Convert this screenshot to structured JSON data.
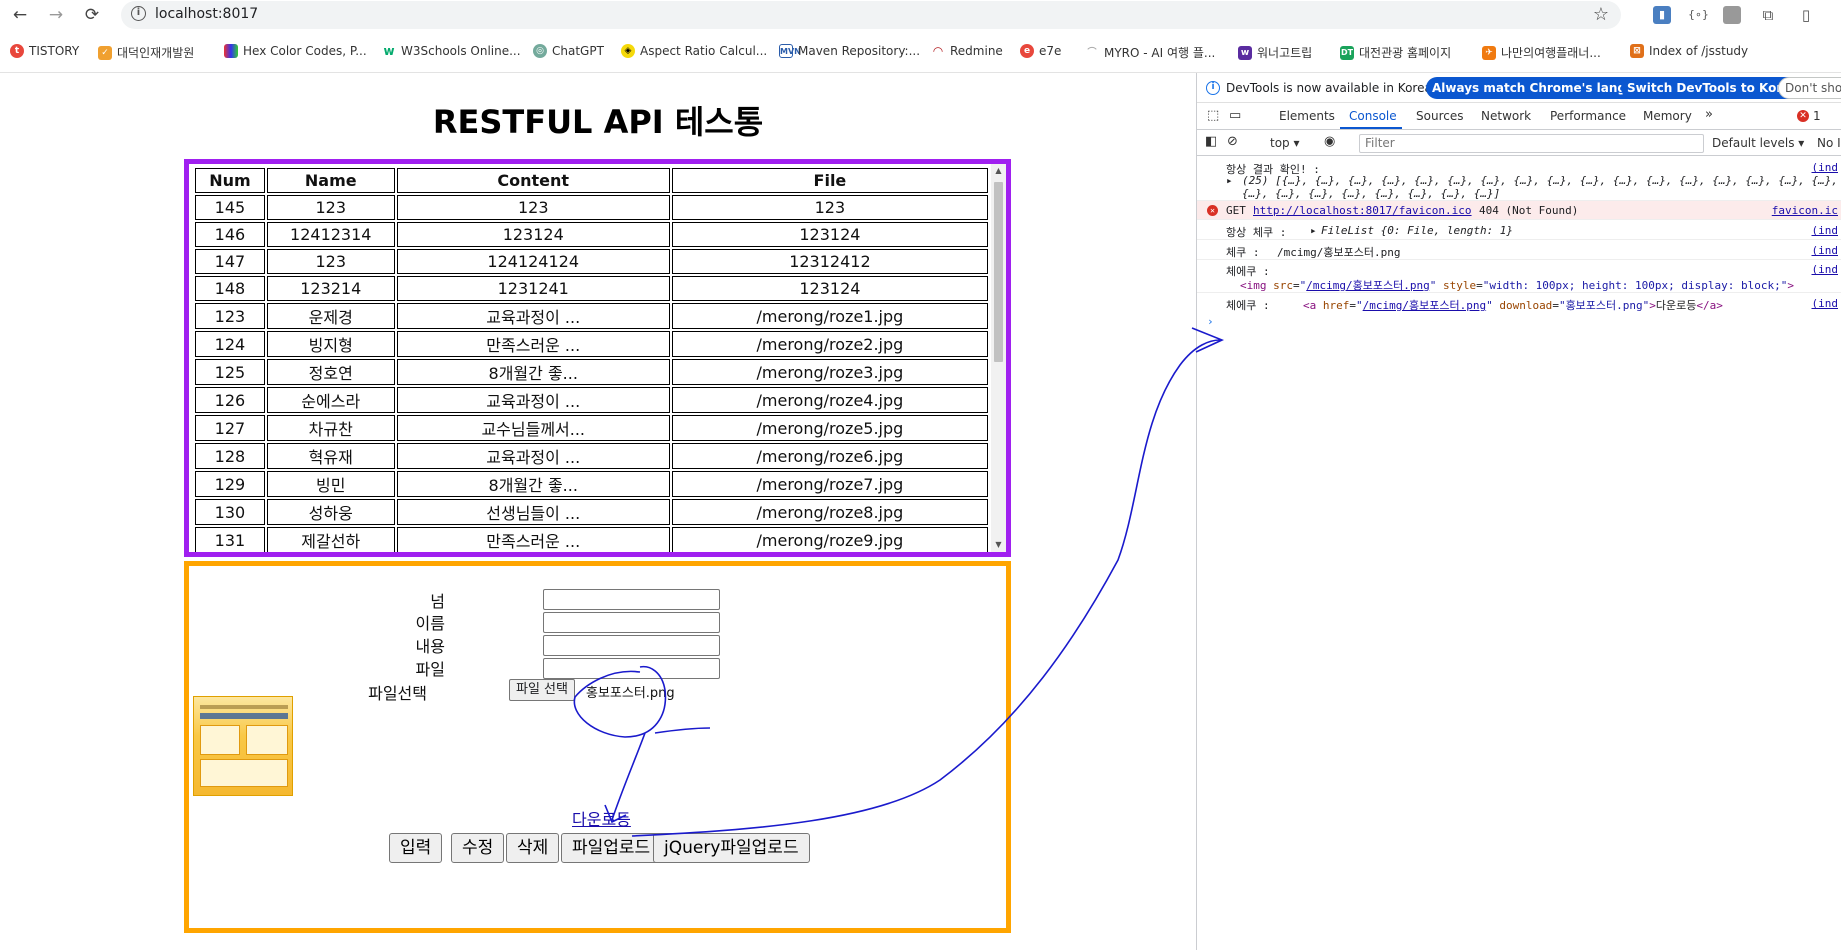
{
  "browser": {
    "url": "localhost:8017",
    "bookmarks": [
      "TISTORY",
      "대덕인재개발원",
      "Hex Color Codes, P...",
      "W3Schools Online...",
      "ChatGPT",
      "Aspect Ratio Calcul...",
      "Maven Repository:...",
      "Redmine",
      "e7e",
      "MYRO - AI 여행 플...",
      "워너고트립",
      "대전관광 홈페이지",
      "나만의여행플래너...",
      "Index of /jsstudy"
    ]
  },
  "page": {
    "title": "RESTFUL API 테스통",
    "table": {
      "headers": [
        "Num",
        "Name",
        "Content",
        "File"
      ],
      "rows": [
        [
          "145",
          "123",
          "123",
          "123"
        ],
        [
          "146",
          "12412314",
          "123124",
          "123124"
        ],
        [
          "147",
          "123",
          "124124124",
          "12312412"
        ],
        [
          "148",
          "123214",
          "1231241",
          "123124"
        ],
        [
          "123",
          "운제경",
          "교육과정이 ...",
          "/merong/roze1.jpg"
        ],
        [
          "124",
          "빙지형",
          "만족스러운 ...",
          "/merong/roze2.jpg"
        ],
        [
          "125",
          "정호연",
          "8개월간 좋...",
          "/merong/roze3.jpg"
        ],
        [
          "126",
          "순에스라",
          "교육과정이 ...",
          "/merong/roze4.jpg"
        ],
        [
          "127",
          "차규찬",
          "교수님들께서...",
          "/merong/roze5.jpg"
        ],
        [
          "128",
          "혁유재",
          "교육과정이 ...",
          "/merong/roze6.jpg"
        ],
        [
          "129",
          "빙민",
          "8개월간 좋...",
          "/merong/roze7.jpg"
        ],
        [
          "130",
          "성하웅",
          "선생님들이 ...",
          "/merong/roze8.jpg"
        ],
        [
          "131",
          "제갈선하",
          "만족스러운 ...",
          "/merong/roze9.jpg"
        ]
      ]
    },
    "form": {
      "labels": [
        "넘",
        "이름",
        "내용",
        "파일"
      ],
      "file_select_label": "파일선택",
      "file_button": "파일 선택",
      "file_name": "홍보포스터.png",
      "download_link": "다운로등",
      "buttons": [
        "입력",
        "수정",
        "삭제",
        "파일업로드",
        "jQuery파일업로드"
      ]
    }
  },
  "devtools": {
    "info_msg": "DevTools is now available in Korean!",
    "btn_match": "Always match Chrome's language",
    "btn_switch": "Switch DevTools to Korean",
    "btn_dont": "Don't show",
    "tabs": [
      "Elements",
      "Console",
      "Sources",
      "Network",
      "Performance",
      "Memory"
    ],
    "error_count": "1",
    "context": "top",
    "filter_placeholder": "Filter",
    "levels": "Default levels",
    "no_issues": "No I",
    "console": {
      "l1_label": "항상 결과 확인! :",
      "l1_array": "(25) [{…}, {…}, {…}, {…}, {…}, {…}, {…}, {…}, {…}, {…}, {…}, {…}, {…}, {…}, {…}, {…}, {…},",
      "l1_array2": "{…}, {…}, {…}, {…}, {…}, {…}, {…}, {…}]",
      "l1_src": "(ind",
      "err_method": "GET",
      "err_url": "http://localhost:8017/favicon.ico",
      "err_status": "404 (Not Found)",
      "err_src": "favicon.ic",
      "l3_label": "항상 체쿠 :",
      "l3_val": "FileList {0: File, length: 1}",
      "l3_src": "(ind",
      "l4_label": "체쿠 :",
      "l4_val": "/mcimg/홍보포스터.png",
      "l4_src": "(ind",
      "l5_label": "체에쿠 :",
      "l5_img_src": "/mcimg/홍보포스터.png",
      "l5_img_style": "width: 100px; height: 100px; display: block;",
      "l5_src": "(ind",
      "l6_label": "체에쿠 :",
      "l6_href": "/mcimg/홍보포스터.png",
      "l6_download": "홍보포스터.png",
      "l6_text": "다운로등",
      "l6_src": "(ind"
    }
  }
}
